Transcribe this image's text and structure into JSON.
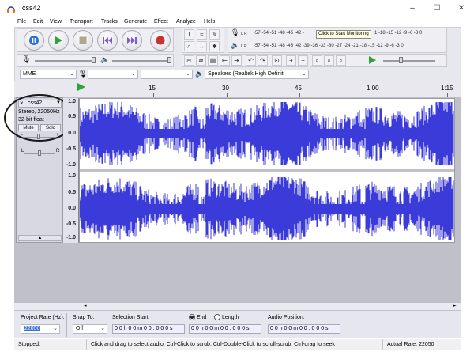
{
  "window": {
    "title": "css42",
    "min": "–",
    "max": "☐",
    "close": "✕"
  },
  "menu": [
    "File",
    "Edit",
    "View",
    "Transport",
    "Tracks",
    "Generate",
    "Effect",
    "Analyze",
    "Help"
  ],
  "meters": {
    "record_scale": "-57  -54  -51  -48  -45  -42  -",
    "record_tooltip": "Click to Start Monitoring",
    "record_scale_right": "1  -18  -15  -12   -9   -6   -3   0",
    "play_scale": "-57  -54  -51  -48  -45  -42  -39  -36  -33  -30  -27  -24  -21  -18  -15  -12   -9   -6   -3   0",
    "lr_top": "L R",
    "lr_bottom": "L R"
  },
  "devices": {
    "host": "MME",
    "input": "",
    "channels": "",
    "output": "Speakers (Realtek High Definiti"
  },
  "timeline": {
    "ticks": [
      {
        "label": "15"
      },
      {
        "label": "30"
      },
      {
        "label": "45"
      },
      {
        "label": "1:00"
      },
      {
        "label": "1:15"
      }
    ]
  },
  "track": {
    "name": "css42",
    "info_line1": "Stereo, 22050Hz",
    "info_line2": "32-bit float",
    "mute": "Mute",
    "solo": "Solo",
    "pan_left": "L",
    "pan_right": "R",
    "gain_minus": "-",
    "gain_plus": "+",
    "scale_top": [
      "1.0",
      "0.5",
      "0.0",
      "-0.5",
      "-1.0"
    ],
    "scale_bottom": [
      "1.0",
      "0.5",
      "0.0",
      "-0.5",
      "-1.0"
    ]
  },
  "selection": {
    "project_rate_label": "Project Rate (Hz):",
    "project_rate": "22050",
    "snap_label": "Snap To:",
    "snap_value": "Off",
    "selection_start_label": "Selection Start:",
    "selection_start": "0 0 h 0 0 m 0 0 . 0 0 0 s",
    "end_label": "End",
    "length_label": "Length",
    "selection_end": "0 0 h 0 0 m 0 0 . 0 0 0 s",
    "audio_position_label": "Audio Position:",
    "audio_position": "0 0 h 0 0 m 0 0 . 0 0 0 s"
  },
  "status": {
    "state": "Stopped.",
    "hint": "Click and drag to select audio, Ctrl-Click to scrub, Ctrl-Double-Click to scroll-scrub, Ctrl-drag to seek",
    "rate": "Actual Rate: 22050"
  },
  "colors": {
    "waveform": "#3b3bd9",
    "pause": "#2e6fd6",
    "play": "#2fa23a",
    "stop": "#b0a88a",
    "skip": "#7a5ad6",
    "record": "#c83232",
    "highlight_circle": "#1a1a1a"
  }
}
